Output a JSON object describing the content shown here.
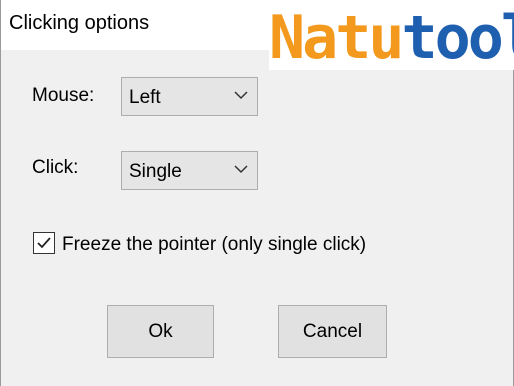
{
  "window": {
    "title": "Clicking options"
  },
  "watermark": {
    "part1": "Natu",
    "part2": "tool",
    "colors": {
      "part1": "#f39a1e",
      "part2": "#1f5fb0"
    }
  },
  "form": {
    "mouse": {
      "label": "Mouse:",
      "selected": "Left"
    },
    "click": {
      "label": "Click:",
      "selected": "Single"
    },
    "freeze": {
      "label": "Freeze the pointer (only single click)",
      "checked": true
    }
  },
  "buttons": {
    "ok": "Ok",
    "cancel": "Cancel"
  },
  "icons": {
    "dropdown": "chevron-down-icon",
    "check": "checkmark-icon"
  }
}
